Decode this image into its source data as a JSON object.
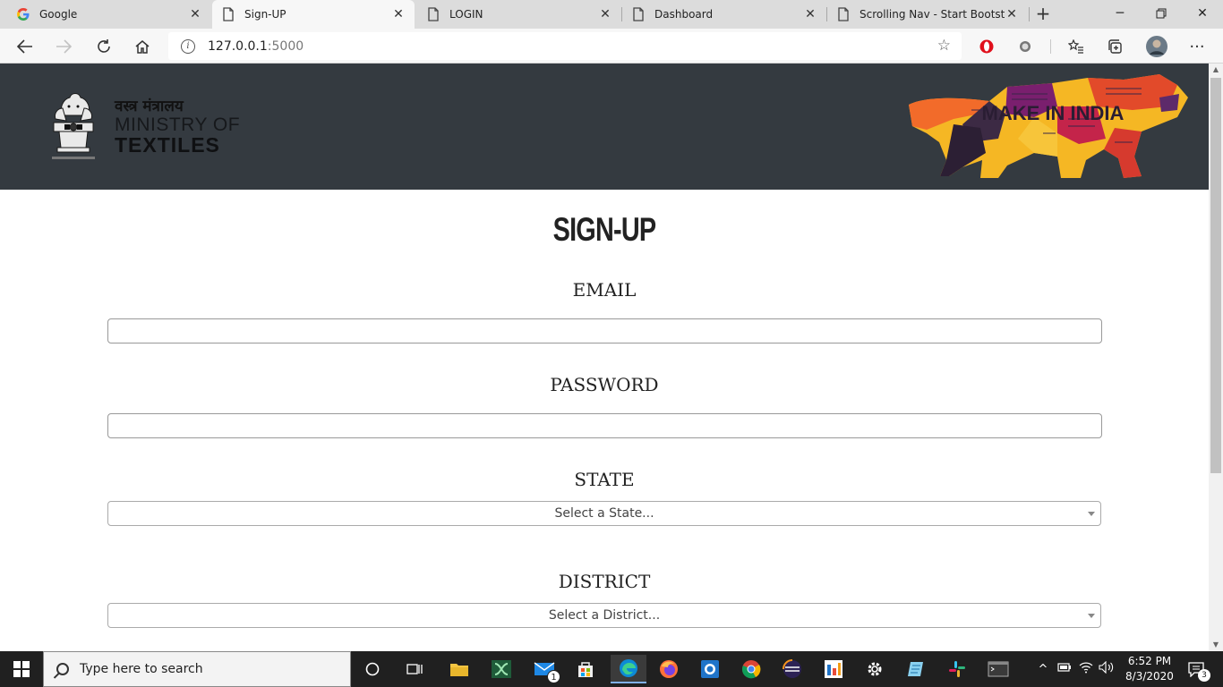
{
  "browser": {
    "tabs": [
      {
        "title": "Google",
        "icon": "google-icon",
        "active": false
      },
      {
        "title": "Sign-UP",
        "icon": "page-icon",
        "active": true
      },
      {
        "title": "LOGIN",
        "icon": "page-icon",
        "active": false
      },
      {
        "title": "Dashboard",
        "icon": "page-icon",
        "active": false
      },
      {
        "title": "Scrolling Nav - Start Bootstrap",
        "icon": "page-icon",
        "active": false
      }
    ],
    "address": {
      "host": "127.0.0.1",
      "port": ":5000"
    }
  },
  "header": {
    "ministry_hindi": "वस्त्र मंत्रालय",
    "ministry_line1": "MINISTRY OF",
    "ministry_line2": "TEXTILES",
    "make_in_india": "MAKE IN INDIA"
  },
  "form": {
    "title": "SIGN-UP",
    "email_label": "EMAIL",
    "email_value": "",
    "password_label": "PASSWORD",
    "password_value": "",
    "state_label": "STATE",
    "state_placeholder": "Select a State...",
    "district_label": "DISTRICT",
    "district_placeholder": "Select a District..."
  },
  "taskbar": {
    "search_placeholder": "Type here to search",
    "mail_badge": "1",
    "notification_badge": "3",
    "time": "6:52 PM",
    "date": "8/3/2020"
  },
  "colors": {
    "header_bg": "#343a40",
    "taskbar_bg": "#202020",
    "accent": "#0078d4"
  }
}
